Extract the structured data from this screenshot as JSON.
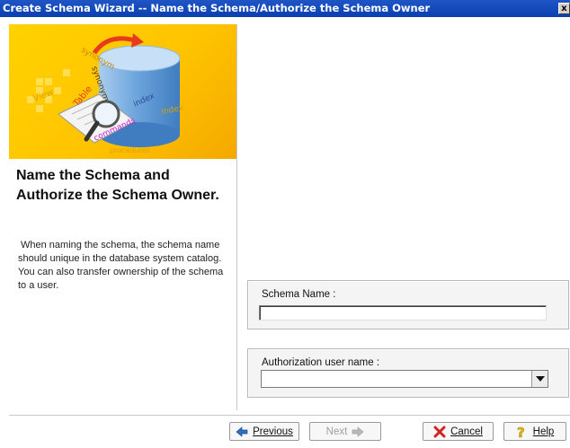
{
  "window": {
    "title": "Create Schema Wizard -- Name the Schema/Authorize the Schema Owner",
    "close_glyph": "x"
  },
  "banner": {
    "words": {
      "synonym": "synonym",
      "view": "View",
      "table": "Table",
      "index": "index",
      "commands": "commands",
      "procedures": "procedures"
    },
    "icons": [
      "database-cylinder-icon",
      "magnifier-icon",
      "document-icon",
      "arrow-icon"
    ],
    "colors": {
      "background": "#ffcc00",
      "cylinder": "#7fb2e0",
      "arrow": "#e83a1c"
    }
  },
  "left": {
    "heading": "Name the Schema and Authorize the Schema Owner.",
    "description": "When naming the schema, the schema name should unique in the database system catalog. You can also transfer ownership of the schema to a user."
  },
  "form": {
    "schema_name_label": "Schema Name :",
    "schema_name_value": "",
    "auth_user_label": "Authorization user name :",
    "auth_user_value": ""
  },
  "buttons": {
    "previous": "Previous",
    "next": "Next",
    "cancel": "Cancel",
    "help": "Help"
  }
}
